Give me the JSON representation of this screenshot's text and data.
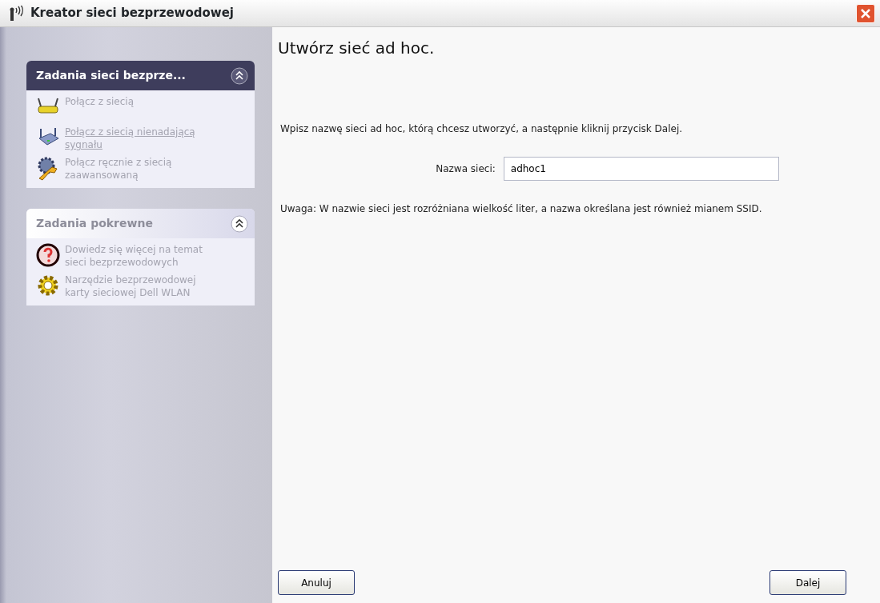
{
  "window": {
    "title": "Kreator sieci bezprzewodowej"
  },
  "sidebar": {
    "panels": [
      {
        "title": "Zadania sieci bezprze...",
        "kind": "primary",
        "expanded": true,
        "items": [
          {
            "label": "Połącz z siecią",
            "underlined": false
          },
          {
            "label": "Połącz z siecią nienadającą sygnału",
            "underlined": true
          },
          {
            "label": "Połącz ręcznie z siecią zaawansowaną",
            "underlined": false
          }
        ]
      },
      {
        "title": "Zadania pokrewne",
        "kind": "secondary",
        "expanded": true,
        "items": [
          {
            "label": "Dowiedz się więcej na temat sieci bezprzewodowych",
            "underlined": false
          },
          {
            "label": "Narzędzie bezprzewodowej karty sieciowej Dell WLAN",
            "underlined": false
          }
        ]
      }
    ]
  },
  "main": {
    "heading": "Utwórz sieć ad hoc.",
    "instruction": "Wpisz nazwę sieci ad hoc, którą chcesz utworzyć, a następnie kliknij przycisk Dalej.",
    "field": {
      "label": "Nazwa sieci:",
      "value": "adhoc1"
    },
    "note": "Uwaga: W nazwie sieci jest rozróżniana wielkość liter, a nazwa określana jest również mianem SSID."
  },
  "buttons": [
    {
      "label": "Anuluj"
    },
    {
      "label": "Dalej"
    }
  ]
}
